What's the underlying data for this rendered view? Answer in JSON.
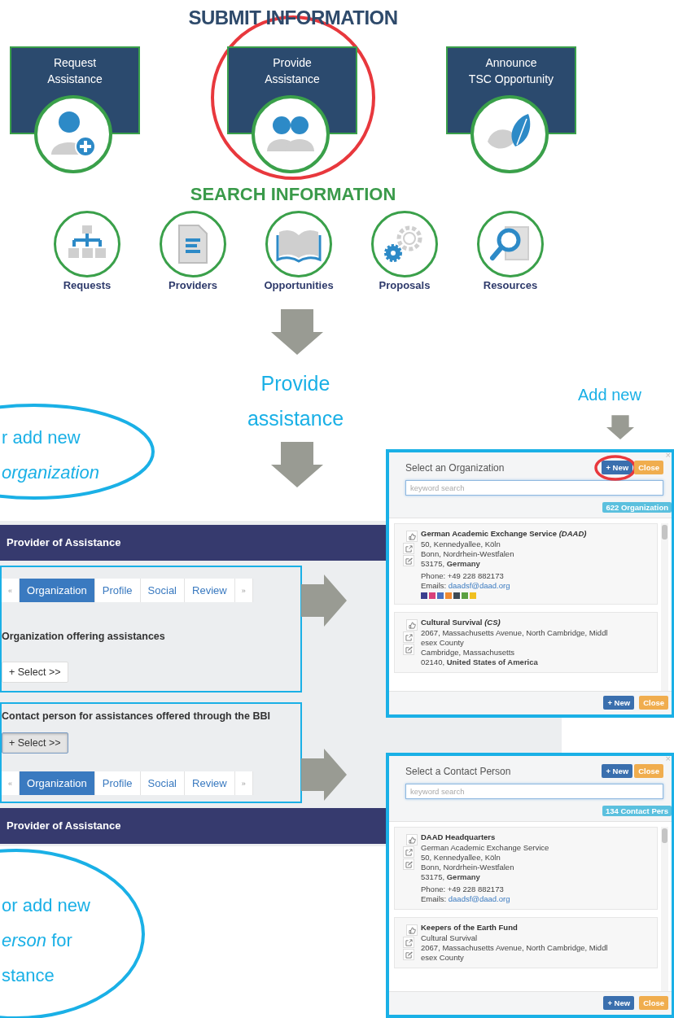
{
  "submit_section": {
    "title": "SUBMIT INFORMATION",
    "tiles": [
      {
        "lines": [
          "Request",
          "Assistance"
        ],
        "highlighted": false
      },
      {
        "lines": [
          "Provide",
          "Assistance"
        ],
        "highlighted": true
      },
      {
        "lines": [
          "Announce",
          "TSC Opportunity"
        ],
        "highlighted": false
      }
    ]
  },
  "search_section": {
    "title": "SEARCH INFORMATION",
    "items": [
      {
        "label": "Requests"
      },
      {
        "label": "Providers"
      },
      {
        "label": "Opportunities"
      },
      {
        "label": "Proposals"
      },
      {
        "label": "Resources"
      }
    ]
  },
  "flow_label": {
    "lines": [
      "Provide",
      "assistance"
    ]
  },
  "add_new_label": "Add new",
  "annotations": [
    {
      "lines": [
        "r add new",
        "*organization*"
      ]
    },
    {
      "lines": [
        "or add new",
        "*erson* for",
        "stance"
      ]
    }
  ],
  "provider_form": {
    "header": "Provider of Assistance",
    "frames": [
      {
        "blocks": [
          {
            "kind": "tabs",
            "tabs": [
              {
                "label": "«",
                "kind": "pager",
                "selected": false
              },
              {
                "label": "Organization",
                "kind": "tab",
                "selected": true
              },
              {
                "label": "Profile",
                "kind": "tab",
                "selected": false
              },
              {
                "label": "Social",
                "kind": "tab",
                "selected": false
              },
              {
                "label": "Review",
                "kind": "tab",
                "selected": false
              },
              {
                "label": "»",
                "kind": "pager",
                "selected": false
              }
            ]
          },
          {
            "kind": "label",
            "text": "Organization offering assistances"
          },
          {
            "kind": "select",
            "label": "+ Select >>",
            "pressed": false
          }
        ]
      },
      {
        "blocks": [
          {
            "kind": "label",
            "text": "Contact person for assistances offered through the BBI"
          },
          {
            "kind": "select",
            "label": "+ Select >>",
            "pressed": true
          },
          {
            "kind": "tabs",
            "tabs": [
              {
                "label": "«",
                "kind": "pager",
                "selected": false
              },
              {
                "label": "Organization",
                "kind": "tab",
                "selected": true
              },
              {
                "label": "Profile",
                "kind": "tab",
                "selected": false
              },
              {
                "label": "Social",
                "kind": "tab",
                "selected": false
              },
              {
                "label": "Review",
                "kind": "tab",
                "selected": false
              },
              {
                "label": "»",
                "kind": "pager",
                "selected": false
              }
            ]
          }
        ]
      }
    ],
    "footer": "Provider of Assistance"
  },
  "dialogs": [
    {
      "title": "Select an Organization",
      "close_glyph": "×",
      "header_buttons": [
        {
          "label": "+ New",
          "kind": "primary",
          "annotated": true
        },
        {
          "label": "Close",
          "kind": "warning",
          "annotated": false
        }
      ],
      "search_placeholder": "keyword search",
      "count": "622 Organization",
      "cards": [
        {
          "name": "German Academic Exchange Service *(DAAD)*",
          "lines": [
            "50, Kennedyallee, Köln",
            "Bonn, Nordrhein-Westfalen",
            "53175, **Germany**"
          ],
          "phone": "Phone: +49 228 882173",
          "email_label": "Emails:",
          "email": "daadsf@daad.org",
          "social_icons": [
            {
              "color": "#3b3f8f"
            },
            {
              "color": "#d9407a"
            },
            {
              "color": "#4a6fc0"
            },
            {
              "color": "#f08a30"
            },
            {
              "color": "#3e4a55"
            },
            {
              "color": "#5aa040"
            },
            {
              "color": "#f0c020"
            }
          ]
        },
        {
          "name": "Cultural Survival *(CS)*",
          "lines": [
            "2067, Massachusetts Avenue, North Cambridge, Middl",
            "esex County",
            "Cambridge, Massachusetts",
            "02140, **United States of America**"
          ]
        }
      ],
      "footer_buttons": [
        {
          "label": "+ New",
          "kind": "primary"
        },
        {
          "label": "Close",
          "kind": "warning"
        }
      ]
    },
    {
      "title": "Select a Contact Person",
      "close_glyph": "×",
      "header_buttons": [
        {
          "label": "+ New",
          "kind": "primary",
          "annotated": false
        },
        {
          "label": "Close",
          "kind": "warning",
          "annotated": false
        }
      ],
      "search_placeholder": "keyword search",
      "count": "134 Contact Pers",
      "cards": [
        {
          "name": "DAAD Headquarters",
          "subtitle": "German Academic Exchange Service",
          "lines": [
            "50, Kennedyallee, Köln",
            "Bonn, Nordrhein-Westfalen",
            "53175, **Germany**"
          ],
          "phone": "Phone: +49 228 882173",
          "email_label": "Emails:",
          "email": "daadsf@daad.org"
        },
        {
          "name": "Keepers of the Earth Fund",
          "subtitle": "Cultural Survival",
          "lines": [
            "2067, Massachusetts Avenue, North Cambridge, Middl",
            "esex County"
          ]
        }
      ],
      "footer_buttons": [
        {
          "label": "+ New",
          "kind": "primary"
        },
        {
          "label": "Close",
          "kind": "warning"
        }
      ]
    }
  ]
}
